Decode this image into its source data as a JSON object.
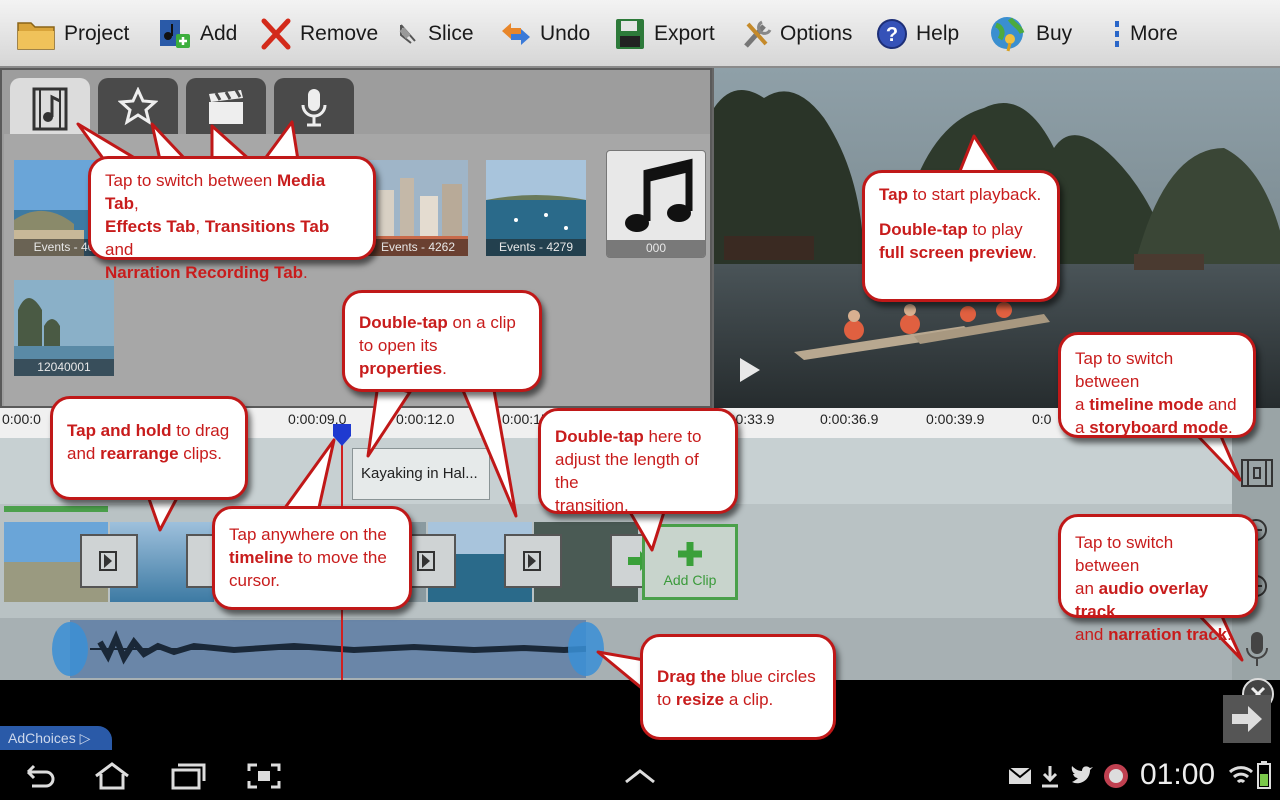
{
  "toolbar": {
    "project": "Project",
    "add": "Add",
    "remove": "Remove",
    "slice": "Slice",
    "undo": "Undo",
    "export": "Export",
    "options": "Options",
    "help": "Help",
    "buy": "Buy",
    "more": "More"
  },
  "media": {
    "items": [
      "Events - 40",
      "Events - 4262",
      "Events - 4279",
      "000",
      "12040001"
    ]
  },
  "timeline": {
    "ticks": [
      "0:00:0",
      "0:00:09.0",
      "0:00:12.0",
      "0:00:15",
      "0:00:33.9",
      "0:00:36.9",
      "0:00:39.9",
      "0:0"
    ],
    "title_clip": "Kayaking in Hal...",
    "add_clip": "Add Clip"
  },
  "ad": {
    "label": "AdChoices"
  },
  "status": {
    "time": "01:00"
  },
  "callouts": {
    "tabs": {
      "p1": "Tap to switch between ",
      "b1": "Media Tab",
      "p2": ",",
      "b2": "Effects Tab",
      "p3": ", ",
      "b3": "Transitions Tab",
      "p4": " and",
      "b4": "Narration Recording Tab",
      "p5": "."
    },
    "playback": {
      "b1": "Tap",
      "p1": " to start playback.",
      "b2": "Double-tap",
      "p2": " to play",
      "b3": "full screen preview",
      "p3": "."
    },
    "clip_props": {
      "b1": "Double-tap",
      "p1": " on a clip",
      "p2": "to open its ",
      "b2": "properties",
      "p3": "."
    },
    "drag": {
      "b1": "Tap and hold",
      "p1": " to drag",
      "p2": "and ",
      "b2": "rearrange",
      "p3": " clips."
    },
    "cursor": {
      "p1": "Tap anywhere on the",
      "b1": "timeline",
      "p2": " to move the",
      "p3": "cursor."
    },
    "transition": {
      "b1": "Double-tap",
      "p1": " here to",
      "p2": "adjust the length of the",
      "p3": "transition."
    },
    "mode": {
      "p1": "Tap to switch between",
      "p2": "a ",
      "b1": "timeline mode",
      "p3": " and",
      "p4": "a ",
      "b2": "storyboard mode",
      "p5": "."
    },
    "audio": {
      "p1": "Tap to switch between",
      "p2": "an ",
      "b1": "audio overlay track",
      "p3": "and ",
      "b2": "narration track",
      "p4": "."
    },
    "resize": {
      "b1": "Drag the",
      "p1": " blue circles",
      "p2": "to ",
      "b2": "resize",
      "p3": " a clip."
    }
  },
  "colors": {
    "accent_red": "#c81c1c",
    "audio_blue": "#3a8fd6"
  }
}
